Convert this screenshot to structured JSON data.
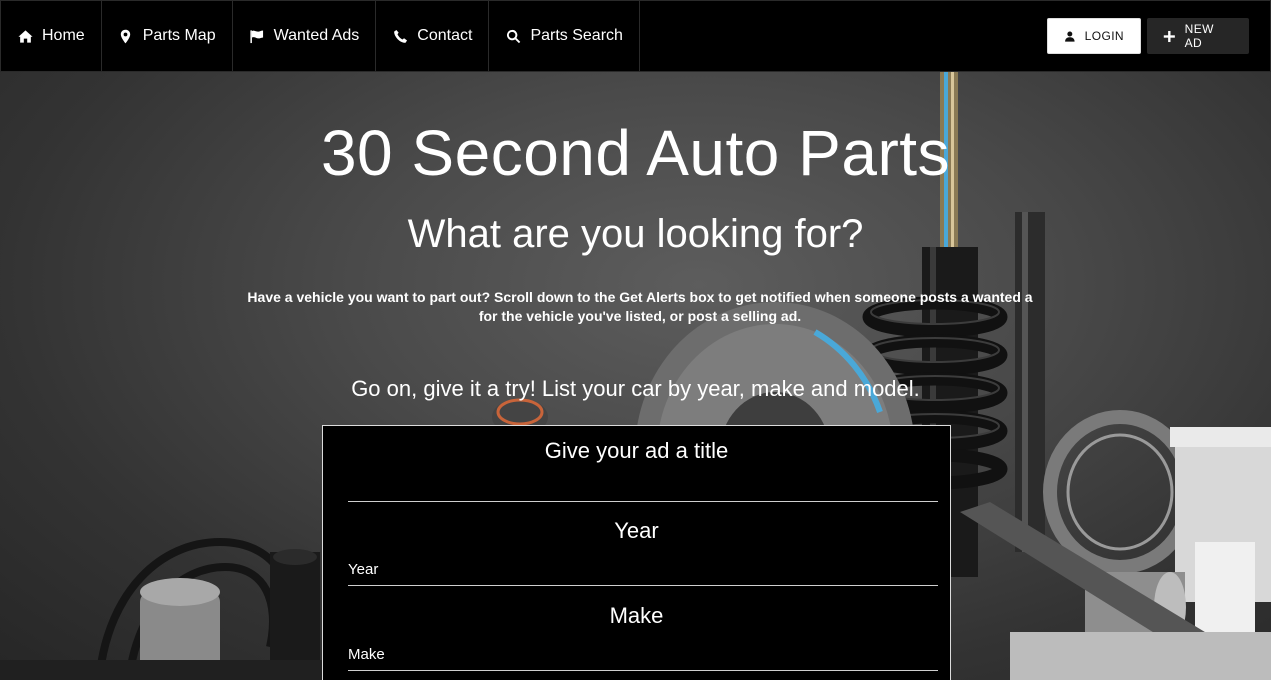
{
  "nav": {
    "items": [
      {
        "label": "Home",
        "icon": "home-icon"
      },
      {
        "label": "Parts Map",
        "icon": "map-marker-icon"
      },
      {
        "label": "Wanted Ads",
        "icon": "flag-icon"
      },
      {
        "label": "Contact",
        "icon": "phone-icon"
      },
      {
        "label": "Parts Search",
        "icon": "search-icon"
      }
    ],
    "login_label": "LOGIN",
    "new_ad_label": "NEW AD"
  },
  "hero": {
    "title": "30 Second Auto Parts",
    "subtitle": "What are you looking for?",
    "description": "Have a vehicle you want to part out? Scroll down to the Get Alerts box to get notified when someone posts a wanted a for the vehicle you've listed, or post a selling ad.",
    "cta": "Go on, give it a try! List your car by year, make and model."
  },
  "form": {
    "title_label": "Give your ad a title",
    "title_value": "",
    "year_label": "Year",
    "year_placeholder": "Year",
    "make_label": "Make",
    "make_placeholder": "Make"
  },
  "colors": {
    "nav_bg": "#000000",
    "accent_blue": "#4aa8d8",
    "form_bg": "#000000"
  }
}
